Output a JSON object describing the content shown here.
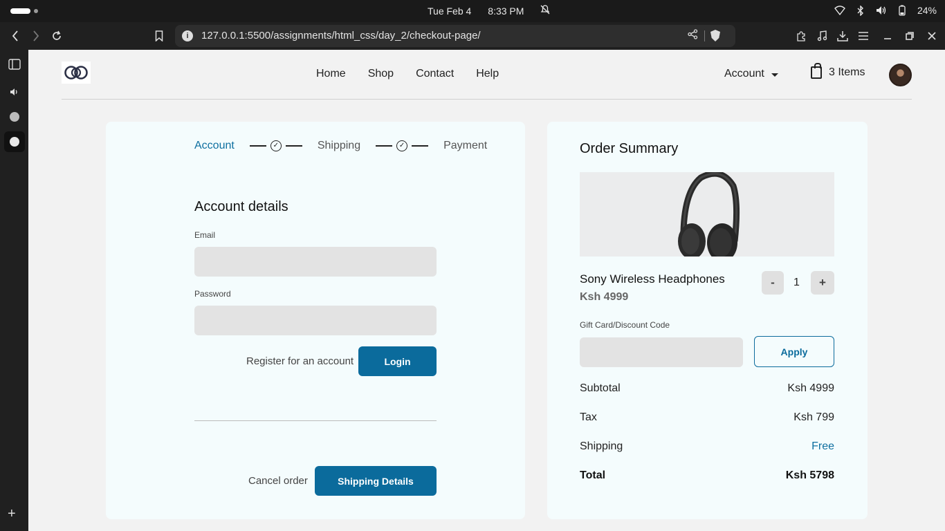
{
  "os": {
    "date": "Tue Feb 4",
    "time": "8:33 PM",
    "battery": "24%"
  },
  "browser": {
    "url": "127.0.0.1:5500/assignments/html_css/day_2/checkout-page/"
  },
  "header": {
    "nav": [
      "Home",
      "Shop",
      "Contact",
      "Help"
    ],
    "account_label": "Account",
    "cart_label": "3 Items"
  },
  "steps": {
    "account": "Account",
    "shipping": "Shipping",
    "payment": "Payment"
  },
  "account_form": {
    "title": "Account details",
    "email_label": "Email",
    "email_value": "",
    "password_label": "Password",
    "password_value": "",
    "register_link": "Register for an account",
    "login_button": "Login",
    "cancel_link": "Cancel order",
    "shipping_button": "Shipping Details"
  },
  "summary": {
    "title": "Order Summary",
    "product_name": "Sony Wireless Headphones",
    "product_price": "Ksh 4999",
    "quantity": "1",
    "minus_label": "-",
    "plus_label": "+",
    "discount_label": "Gift Card/Discount Code",
    "discount_value": "",
    "apply_button": "Apply",
    "subtotal_label": "Subtotal",
    "subtotal_value": "Ksh 4999",
    "tax_label": "Tax",
    "tax_value": "Ksh 799",
    "shipping_label": "Shipping",
    "shipping_value": "Free",
    "total_label": "Total",
    "total_value": "Ksh 5798"
  },
  "colors": {
    "accent": "#0b6b9c",
    "card_bg": "#f4fcfd",
    "page_bg": "#f2f2f2",
    "input_bg": "#e3e3e3"
  },
  "icons": {
    "back": "chevron-left-icon",
    "forward": "chevron-right-icon",
    "reload": "reload-icon",
    "bookmark": "bookmark-icon",
    "share": "share-icon",
    "cart": "shopping-bag-icon",
    "step_check": "check-circle-icon"
  }
}
